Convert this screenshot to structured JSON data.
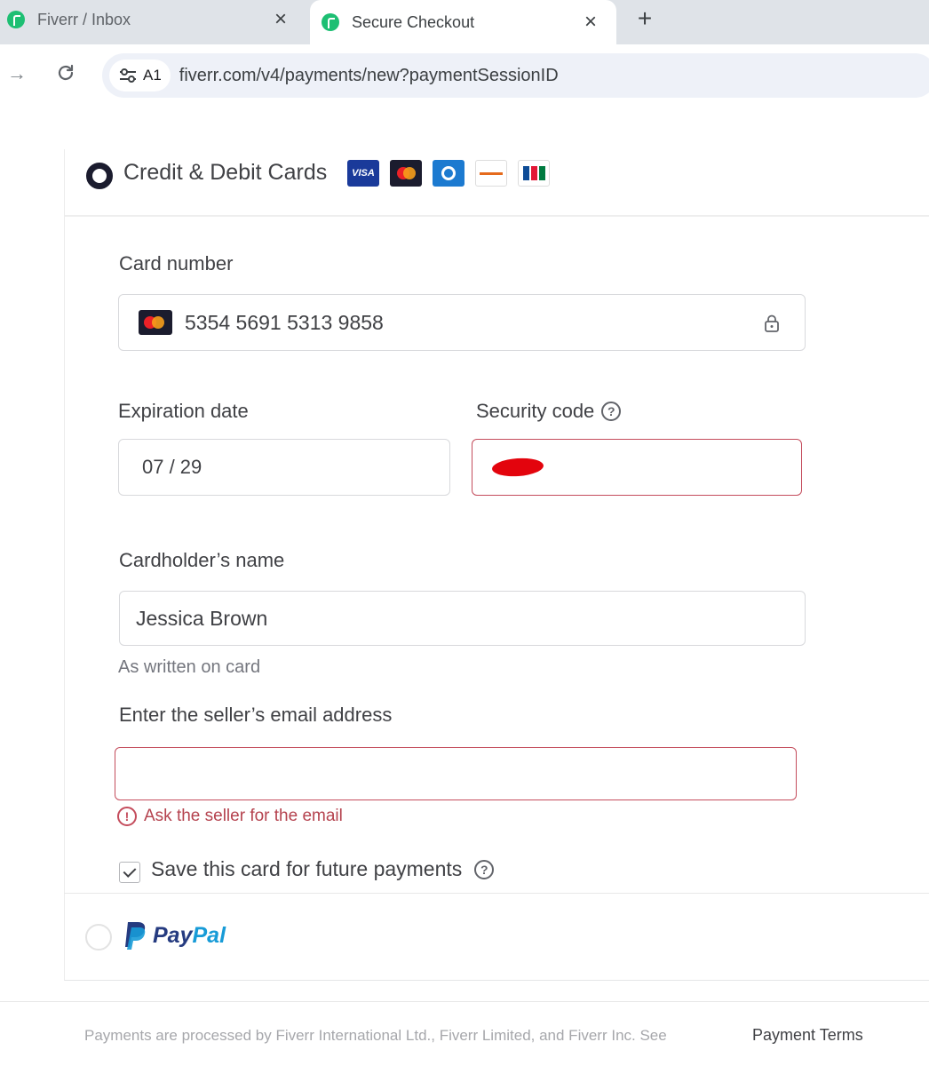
{
  "browser": {
    "tabs": [
      {
        "title": "Fiverr / Inbox",
        "active": false
      },
      {
        "title": "Secure Checkout",
        "active": true
      }
    ],
    "site_info_label": "A1",
    "url": "fiverr.com/v4/payments/new?paymentSessionID"
  },
  "payment": {
    "card_method": {
      "title": "Credit & Debit Cards",
      "selected": true,
      "brands": [
        "visa",
        "mastercard",
        "diners",
        "discover",
        "jcb"
      ],
      "visa_text": "VISA"
    },
    "card_number": {
      "label": "Card number",
      "value": "5354 5691 5313 9858"
    },
    "expiration": {
      "label": "Expiration date",
      "value": "07 / 29"
    },
    "security_code": {
      "label": "Security code",
      "help": "?"
    },
    "cardholder": {
      "label": "Cardholder’s name",
      "value": "Jessica Brown",
      "hint": "As written on card"
    },
    "seller_email": {
      "label": "Enter the seller’s email address",
      "value": "",
      "error": "Ask the seller for the email"
    },
    "save_card": {
      "label": "Save this card for future payments",
      "checked": true
    },
    "paypal": {
      "pay": "Pay",
      "pal": "Pal",
      "selected": false
    }
  },
  "footer": {
    "text": "Payments are processed by Fiverr International Ltd., Fiverr Limited, and Fiverr Inc. See",
    "link": "Payment Terms"
  },
  "colors": {
    "fiverr_green": "#1dbf73",
    "error": "#c44c5c",
    "redaction": "#e3040d",
    "paypal_dark": "#253b80",
    "paypal_light": "#179bd7"
  }
}
